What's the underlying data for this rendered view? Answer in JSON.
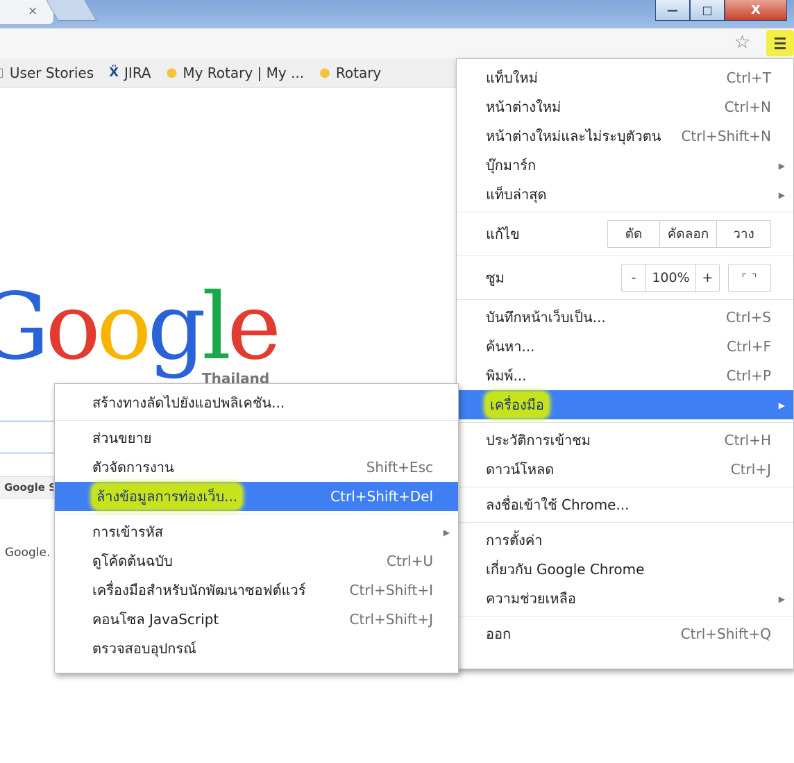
{
  "titlebar": {
    "tab_close": "×",
    "window_buttons": {
      "minimize": "—",
      "maximize": "□",
      "close": "X"
    }
  },
  "toolbar": {
    "star_icon": "☆"
  },
  "bookmarks": [
    {
      "icon": "doc-icon",
      "label": "User Stories"
    },
    {
      "icon": "jira-icon",
      "label": "JIRA"
    },
    {
      "icon": "rotary-icon",
      "label": "My Rotary | My ..."
    },
    {
      "icon": "rotary-icon",
      "label": "Rotary"
    }
  ],
  "page": {
    "logo_letters": [
      "G",
      "o",
      "o",
      "g",
      "l",
      "e"
    ],
    "logo_sub": "Thailand",
    "search_button": "Google S",
    "footer": "Google."
  },
  "main_menu": {
    "new_tab": {
      "label": "แท็บใหม่",
      "shortcut": "Ctrl+T"
    },
    "new_window": {
      "label": "หน้าต่างใหม่",
      "shortcut": "Ctrl+N"
    },
    "incognito": {
      "label": "หน้าต่างใหม่และไม่ระบุตัวตน",
      "shortcut": "Ctrl+Shift+N"
    },
    "bookmarks": {
      "label": "บุ๊กมาร์ก"
    },
    "recent_tabs": {
      "label": "แท็บล่าสุด"
    },
    "edit": {
      "label": "แก้ไข",
      "cut": "ตัด",
      "copy": "คัดลอก",
      "paste": "วาง"
    },
    "zoom": {
      "label": "ซูม",
      "minus": "-",
      "value": "100%",
      "plus": "+",
      "fullscreen": "⌜ ⌝"
    },
    "save_page": {
      "label": "บันทึกหน้าเว็บเป็น...",
      "shortcut": "Ctrl+S"
    },
    "find": {
      "label": "ค้นหา...",
      "shortcut": "Ctrl+F"
    },
    "print": {
      "label": "พิมพ์...",
      "shortcut": "Ctrl+P"
    },
    "tools": {
      "label": "เครื่องมือ"
    },
    "history": {
      "label": "ประวัติการเข้าชม",
      "shortcut": "Ctrl+H"
    },
    "downloads": {
      "label": "ดาวน์โหลด",
      "shortcut": "Ctrl+J"
    },
    "signin": {
      "label": "ลงชื่อเข้าใช้ Chrome..."
    },
    "settings": {
      "label": "การตั้งค่า"
    },
    "about": {
      "label": "เกี่ยวกับ Google Chrome"
    },
    "help": {
      "label": "ความช่วยเหลือ"
    },
    "exit": {
      "label": "ออก",
      "shortcut": "Ctrl+Shift+Q"
    }
  },
  "tools_menu": {
    "create_shortcut": {
      "label": "สร้างทางลัดไปยังแอปพลิเคชัน..."
    },
    "extensions": {
      "label": "ส่วนขยาย"
    },
    "task_manager": {
      "label": "ตัวจัดการงาน",
      "shortcut": "Shift+Esc"
    },
    "clear_browsing": {
      "label": "ล้างข้อมูลการท่องเว็บ...",
      "shortcut": "Ctrl+Shift+Del"
    },
    "encoding": {
      "label": "การเข้ารหัส"
    },
    "view_source": {
      "label": "ดูโค้ดต้นฉบับ",
      "shortcut": "Ctrl+U"
    },
    "dev_tools": {
      "label": "เครื่องมือสำหรับนักพัฒนาซอฟต์แวร์",
      "shortcut": "Ctrl+Shift+I"
    },
    "js_console": {
      "label": "คอนโซล JavaScript",
      "shortcut": "Ctrl+Shift+J"
    },
    "inspect_devices": {
      "label": "ตรวจสอบอุปกรณ์"
    }
  },
  "colors": {
    "selection": "#3f7ff3",
    "highlighter": "#c6e31c",
    "menu_button_highlight": "#f4ee45"
  }
}
